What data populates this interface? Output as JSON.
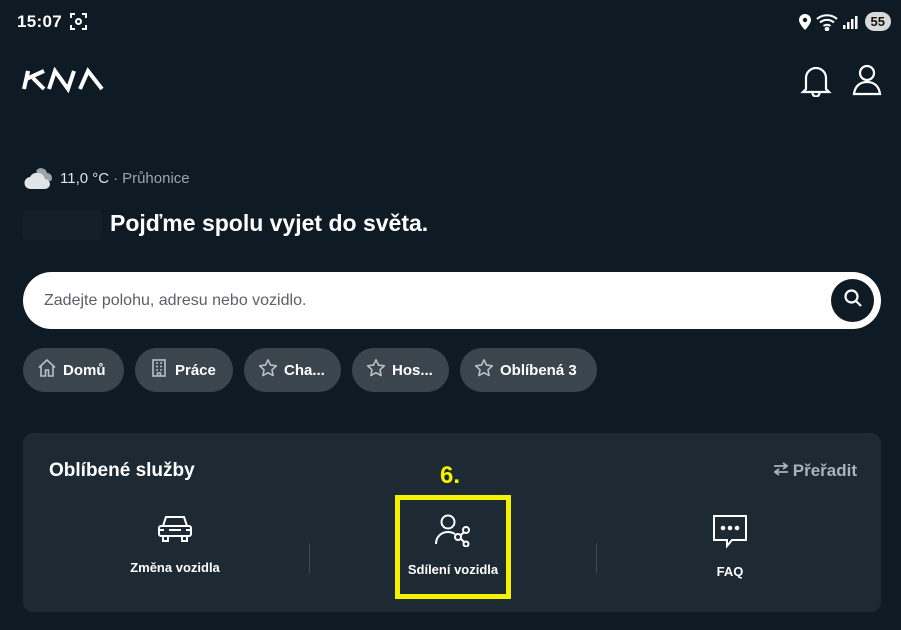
{
  "status_bar": {
    "time": "15:07",
    "battery": "55",
    "icons": [
      "screenshot-icon",
      "location-icon",
      "wifi-icon",
      "signal-icon"
    ]
  },
  "header": {
    "logo": "KIA",
    "icons": [
      "bell-icon",
      "user-icon"
    ]
  },
  "weather": {
    "icon": "cloud-icon",
    "temperature": "11,0 °C",
    "separator": "·",
    "location": "Průhonice"
  },
  "greeting": "Pojďme spolu vyjet do světa.",
  "search": {
    "placeholder": "Zadejte polohu, adresu nebo vozidlo.",
    "value": "",
    "icon": "search-icon"
  },
  "chips": [
    {
      "label": "Domů",
      "icon": "home-icon"
    },
    {
      "label": "Práce",
      "icon": "building-icon"
    },
    {
      "label": "Cha...",
      "icon": "star-icon"
    },
    {
      "label": "Hos...",
      "icon": "star-icon"
    },
    {
      "label": "Oblíbená 3",
      "icon": "star-icon"
    }
  ],
  "services": {
    "title": "Oblíbené služby",
    "reorder_label": "Přeřadit",
    "items": [
      {
        "label": "Změna vozidla",
        "icon": "car-icon"
      },
      {
        "label": "Sdílení vozidla",
        "icon": "share-user-icon"
      },
      {
        "label": "FAQ",
        "icon": "chat-bubble-icon"
      }
    ]
  },
  "annotation": {
    "step": "6.",
    "color": "#f5f200"
  },
  "colors": {
    "background": "#0f1b24",
    "card": "#1d2a33",
    "chip": "#3a454e",
    "search_bg": "#ffffff"
  }
}
